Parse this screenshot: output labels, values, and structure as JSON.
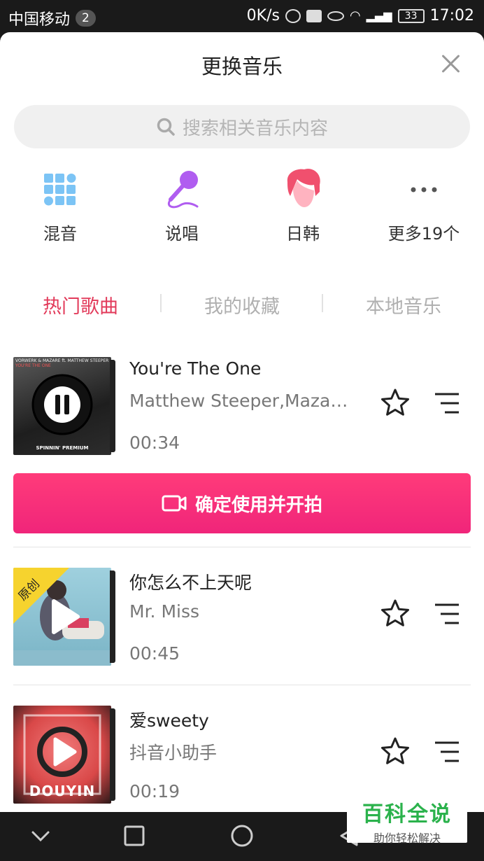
{
  "status_bar": {
    "carrier": "中国移动",
    "notification_count": "2",
    "speed": "0K/s",
    "battery": "33",
    "time": "17:02"
  },
  "header": {
    "title": "更换音乐"
  },
  "search": {
    "placeholder": "搜索相关音乐内容"
  },
  "categories": [
    {
      "label": "混音",
      "icon": "grid-icon"
    },
    {
      "label": "说唱",
      "icon": "microphone-icon"
    },
    {
      "label": "日韩",
      "icon": "avatar-icon"
    },
    {
      "label": "更多19个",
      "icon": "more-dots-icon"
    }
  ],
  "tabs": [
    {
      "label": "热门歌曲",
      "active": true
    },
    {
      "label": "我的收藏",
      "active": false
    },
    {
      "label": "本地音乐",
      "active": false
    }
  ],
  "songs": [
    {
      "title": "You're The One",
      "artist": "Matthew Steeper,Mazare,Vorwerk",
      "duration": "00:34",
      "state": "playing",
      "cover_text_top": "VORWERK & MAZARE ft. MATTHEW STEEPER",
      "cover_text_sub": "YOU'RE THE ONE",
      "cover_label": "SPINNIN' PREMIUM"
    },
    {
      "title": "你怎么不上天呢",
      "artist": "Mr. Miss",
      "duration": "00:45",
      "state": "paused",
      "badge": "原创"
    },
    {
      "title": "爱sweety",
      "artist": "抖音小助手",
      "duration": "00:19",
      "state": "paused",
      "cover_label": "DOUYIN"
    }
  ],
  "confirm_button": {
    "label": "确定使用并开拍"
  },
  "watermark": {
    "main": "百科全说",
    "sub": "助你轻松解决"
  },
  "colors": {
    "accent": "#e23a5a",
    "button": "#f0257a",
    "watermark": "#2bb24c"
  }
}
